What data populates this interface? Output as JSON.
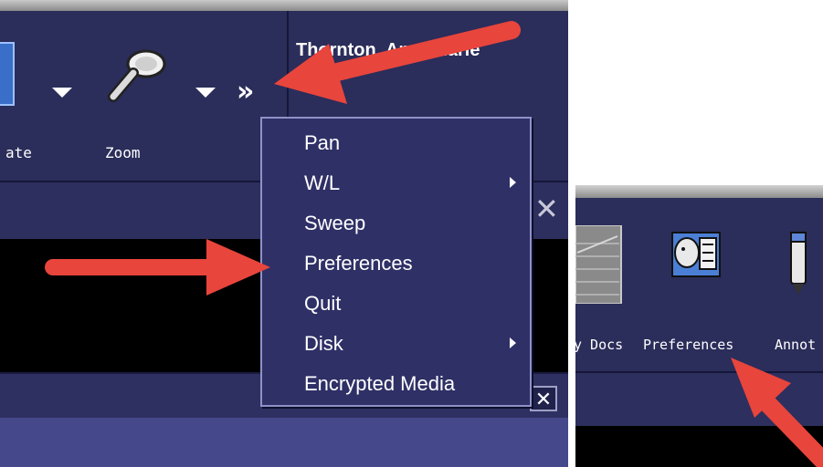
{
  "left_panel": {
    "title": "Thornton, Annamarie",
    "toolbar": [
      {
        "label": "ate",
        "icon": "rotate-icon"
      },
      {
        "label": "Zoom",
        "icon": "magnifier-icon"
      }
    ],
    "overflow_icon": "double-chevron-right-icon"
  },
  "menu": {
    "items": [
      {
        "label": "Pan",
        "submenu": false
      },
      {
        "label": "W/L",
        "submenu": true
      },
      {
        "label": "Sweep",
        "submenu": false
      },
      {
        "label": "Preferences",
        "submenu": false
      },
      {
        "label": "Quit",
        "submenu": false
      },
      {
        "label": "Disk",
        "submenu": true
      },
      {
        "label": "Encrypted Media",
        "submenu": false
      }
    ]
  },
  "right_panel": {
    "toolbar": [
      {
        "label": "y Docs",
        "icon": "docs-icon"
      },
      {
        "label": "Preferences",
        "icon": "preferences-icon"
      },
      {
        "label": "Annot",
        "icon": "annotate-pen-icon"
      }
    ]
  },
  "colors": {
    "toolbar_bg": "#2b2d5a",
    "menu_bg": "#2f3066",
    "annotation_arrow": "#e8453c"
  }
}
